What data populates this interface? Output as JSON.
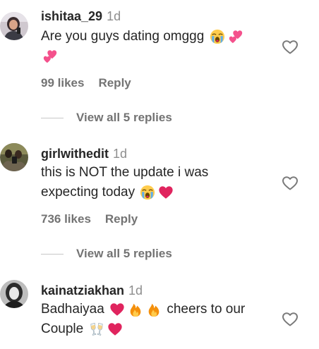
{
  "comments": [
    {
      "username": "ishitaa_29",
      "time": "1d",
      "text": "Are you guys dating omggg",
      "likes": "99 likes",
      "reply": "Reply",
      "view_replies": "View all 5 replies"
    },
    {
      "username": "girlwithedit",
      "time": "1d",
      "text_line1": "this is NOT the update i was",
      "text_line2": "expecting today",
      "likes": "736 likes",
      "reply": "Reply",
      "view_replies": "View all 5 replies"
    },
    {
      "username": "kainatziakhan",
      "time": "1d",
      "text_part1": "Badhaiyaa",
      "text_part2": "cheers to our",
      "text_line2": "Couple"
    }
  ],
  "icons": {
    "like": "heart-outline-icon",
    "emoji_crying": "loudly-crying-face",
    "emoji_two_hearts": "two-hearts",
    "emoji_red_heart": "red-heart",
    "emoji_fire": "fire",
    "emoji_clink": "clinking-glasses"
  },
  "colors": {
    "username": "#262626",
    "muted": "#737373",
    "time": "#8e8e8e",
    "heart": "#e0245e",
    "fire": "#f4900c"
  }
}
